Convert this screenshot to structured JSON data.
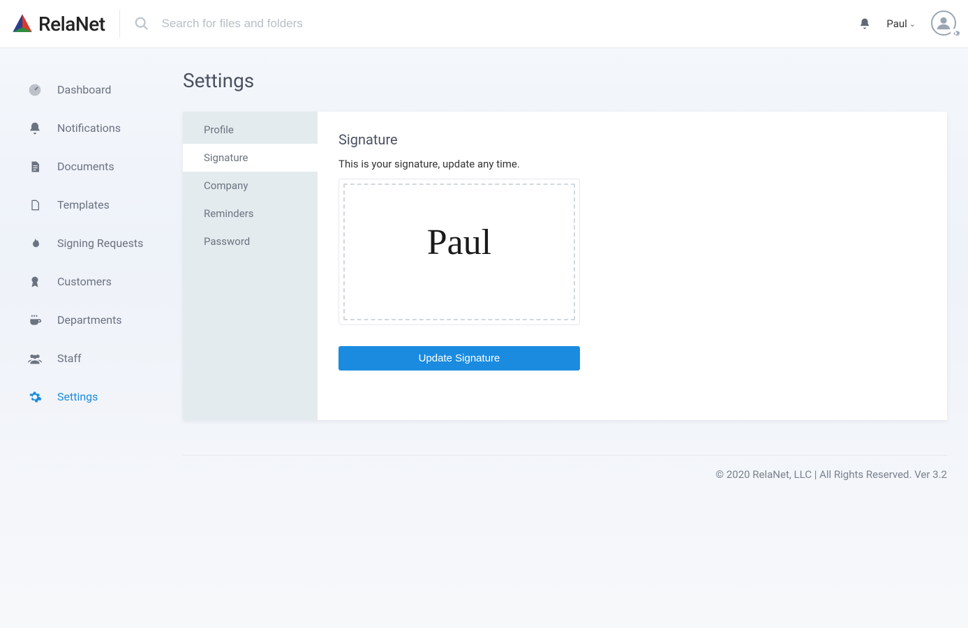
{
  "brand": {
    "name": "RelaNet"
  },
  "search": {
    "placeholder": "Search for files and folders"
  },
  "user": {
    "name": "Paul"
  },
  "sidebar": {
    "items": [
      {
        "label": "Dashboard",
        "icon": "dashboard-icon"
      },
      {
        "label": "Notifications",
        "icon": "bell-icon"
      },
      {
        "label": "Documents",
        "icon": "document-icon"
      },
      {
        "label": "Templates",
        "icon": "template-icon"
      },
      {
        "label": "Signing Requests",
        "icon": "flame-icon"
      },
      {
        "label": "Customers",
        "icon": "ribbon-icon"
      },
      {
        "label": "Departments",
        "icon": "coffee-icon"
      },
      {
        "label": "Staff",
        "icon": "people-icon"
      },
      {
        "label": "Settings",
        "icon": "gear-icon",
        "active": true
      }
    ]
  },
  "page": {
    "title": "Settings"
  },
  "settings": {
    "tabs": [
      {
        "label": "Profile"
      },
      {
        "label": "Signature",
        "active": true
      },
      {
        "label": "Company"
      },
      {
        "label": "Reminders"
      },
      {
        "label": "Password"
      }
    ],
    "signature": {
      "heading": "Signature",
      "description": "This is your signature, update any time.",
      "value": "Paul",
      "button": "Update Signature"
    }
  },
  "footer": {
    "text": "© 2020 RelaNet, LLC | All Rights Reserved. Ver 3.2"
  }
}
